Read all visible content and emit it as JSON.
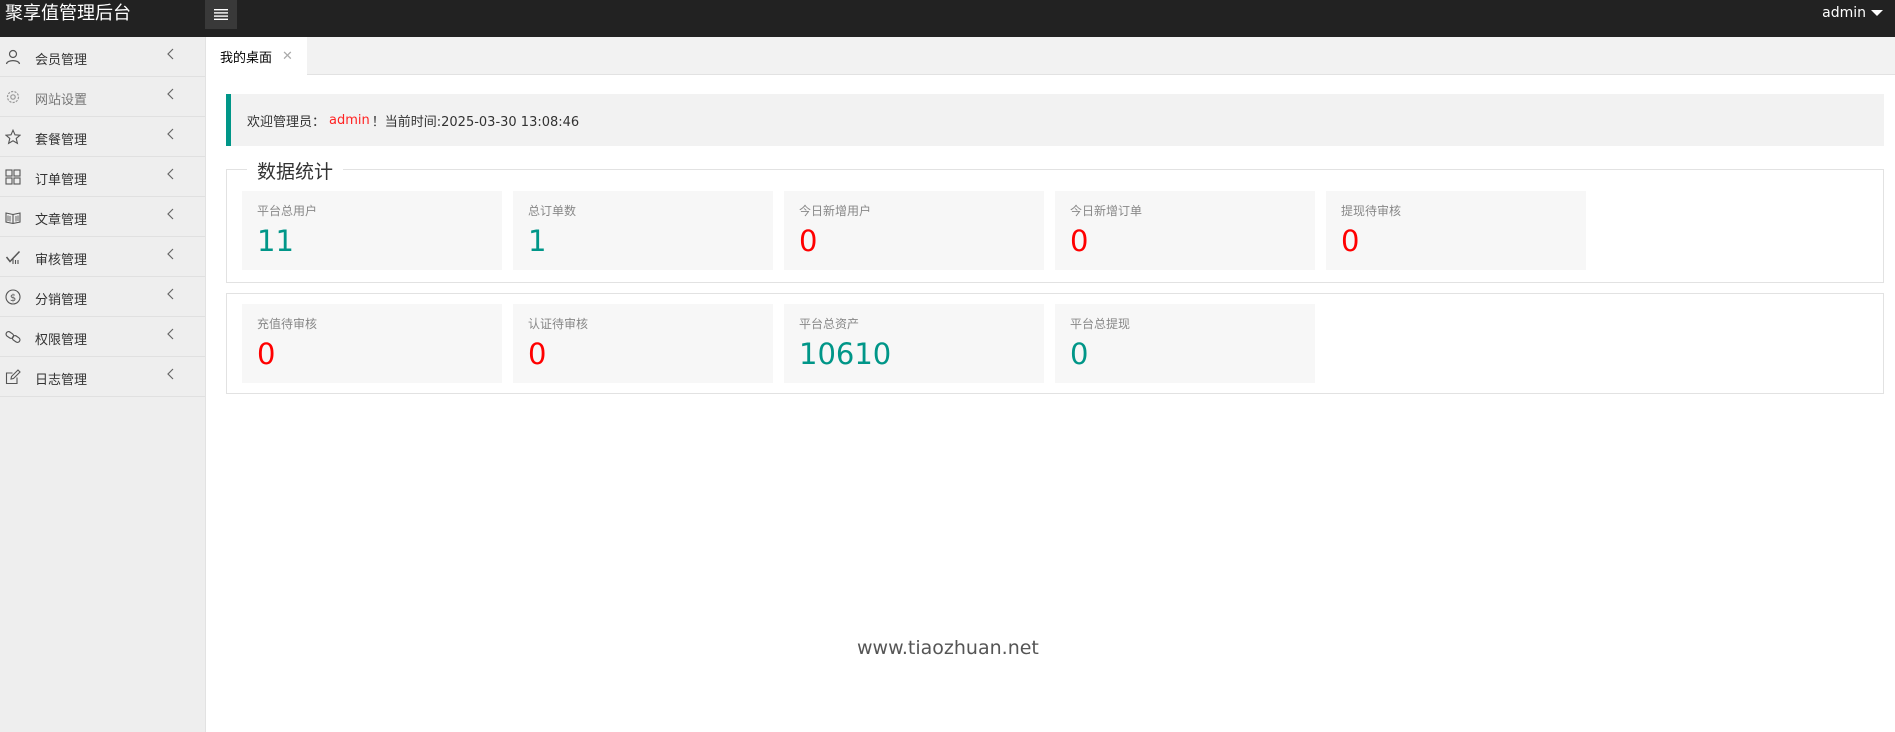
{
  "header": {
    "app_title": "聚享值管理后台",
    "menu_toggle_icon": "hamburger-icon",
    "user": "admin"
  },
  "sidebar": {
    "items": [
      {
        "label": "会员管理",
        "icon": "user-icon"
      },
      {
        "label": "网站设置",
        "icon": "gear-icon"
      },
      {
        "label": "套餐管理",
        "icon": "star-icon"
      },
      {
        "label": "订单管理",
        "icon": "grid-icon"
      },
      {
        "label": "文章管理",
        "icon": "book-icon"
      },
      {
        "label": "审核管理",
        "icon": "check-icon"
      },
      {
        "label": "分销管理",
        "icon": "dollar-icon"
      },
      {
        "label": "权限管理",
        "icon": "link-icon"
      },
      {
        "label": "日志管理",
        "icon": "edit-icon"
      }
    ]
  },
  "tabs": {
    "active": "我的桌面",
    "close_symbol": "✕"
  },
  "welcome": {
    "prefix": "欢迎管理员：",
    "username": "admin",
    "suffix": "！当前时间:2025-03-30 13:08:46"
  },
  "stats": {
    "legend": "数据统计",
    "row1": [
      {
        "title": "平台总用户",
        "value": "11",
        "color": "#009688"
      },
      {
        "title": "总订单数",
        "value": "1",
        "color": "#009688"
      },
      {
        "title": "今日新增用户",
        "value": "0",
        "color": "#ff0000"
      },
      {
        "title": "今日新增订单",
        "value": "0",
        "color": "#ff0000"
      },
      {
        "title": "提现待审核",
        "value": "0",
        "color": "#ff0000"
      }
    ],
    "row2": [
      {
        "title": "充值待审核",
        "value": "0",
        "color": "#ff0000"
      },
      {
        "title": "认证待审核",
        "value": "0",
        "color": "#ff0000"
      },
      {
        "title": "平台总资产",
        "value": "10610",
        "color": "#009688"
      },
      {
        "title": "平台总提现",
        "value": "0",
        "color": "#009688"
      }
    ]
  },
  "watermark": "www.tiaozhuan.net",
  "colors": {
    "topbar": "#222222",
    "accent": "#009688",
    "alert": "#ff0000"
  }
}
